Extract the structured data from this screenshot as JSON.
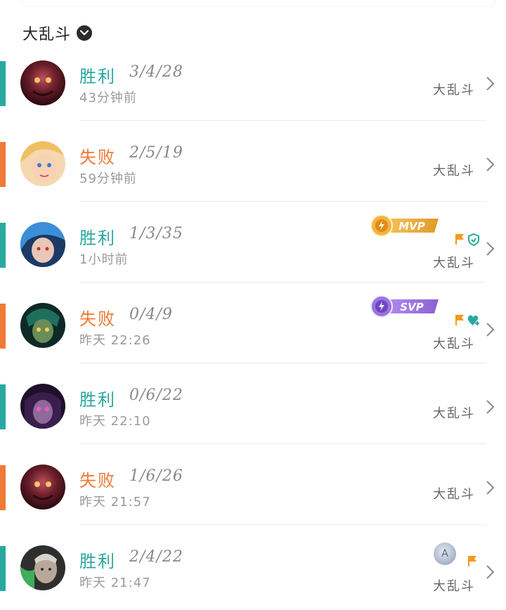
{
  "filter": {
    "label": "大乱斗"
  },
  "matches": [
    {
      "result": "胜利",
      "outcome": "win",
      "kda": "3/4/28",
      "time": "43分钟前",
      "mode": "大乱斗",
      "badge": null,
      "flag": false,
      "extra_icon": null
    },
    {
      "result": "失败",
      "outcome": "loss",
      "kda": "2/5/19",
      "time": "59分钟前",
      "mode": "大乱斗",
      "badge": null,
      "flag": false,
      "extra_icon": null
    },
    {
      "result": "胜利",
      "outcome": "win",
      "kda": "1/3/35",
      "time": "1小时前",
      "mode": "大乱斗",
      "badge": "MVP",
      "flag": true,
      "extra_icon": "shield-icon"
    },
    {
      "result": "失败",
      "outcome": "loss",
      "kda": "0/4/9",
      "time": "昨天 22:26",
      "mode": "大乱斗",
      "badge": "SVP",
      "flag": true,
      "extra_icon": "heart-plus-icon"
    },
    {
      "result": "胜利",
      "outcome": "win",
      "kda": "0/6/22",
      "time": "昨天 22:10",
      "mode": "大乱斗",
      "badge": null,
      "flag": false,
      "extra_icon": null
    },
    {
      "result": "失败",
      "outcome": "loss",
      "kda": "1/6/26",
      "time": "昨天 21:57",
      "mode": "大乱斗",
      "badge": null,
      "flag": false,
      "extra_icon": null
    },
    {
      "result": "胜利",
      "outcome": "win",
      "kda": "2/4/22",
      "time": "昨天 21:47",
      "mode": "大乱斗",
      "badge": null,
      "flag": true,
      "extra_icon": null,
      "rank_badge": "A"
    }
  ],
  "badges": {
    "mvp_label": "MVP",
    "svp_label": "SVP"
  },
  "colors": {
    "win": "#2aa8a0",
    "loss": "#ef7a35",
    "mvp": "#e7a22a",
    "svp": "#8a63d2"
  }
}
